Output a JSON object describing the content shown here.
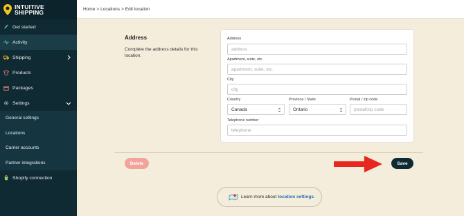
{
  "brand": {
    "line1": "INTUITIVE",
    "line2": "SHIPPING",
    "accent": "#f5c518"
  },
  "sidebar": {
    "items": [
      {
        "label": "Get started",
        "icon": "rocket-icon"
      },
      {
        "label": "Activity",
        "icon": "activity-icon",
        "active": true
      },
      {
        "label": "Shipping",
        "icon": "truck-icon",
        "chevron": "right"
      },
      {
        "label": "Products",
        "icon": "shirt-icon"
      },
      {
        "label": "Packages",
        "icon": "package-icon"
      },
      {
        "label": "Settings",
        "icon": "gear-icon",
        "chevron": "down"
      }
    ],
    "sub_items": [
      "General settings",
      "Locations",
      "Carrier accounts",
      "Partner integrations"
    ],
    "shopify": {
      "label": "Shopify connection",
      "icon": "shopify-icon"
    }
  },
  "breadcrumb": {
    "home": "Home",
    "sep": ">",
    "locations": "Locations",
    "current": "Edit location"
  },
  "section": {
    "title": "Address",
    "description": "Complete the address details for this location."
  },
  "form": {
    "address": {
      "label": "Address",
      "placeholder": "address"
    },
    "apartment": {
      "label": "Apartment, suite, etc.",
      "placeholder": "apartment, suite, etc."
    },
    "city": {
      "label": "City",
      "placeholder": "city"
    },
    "country": {
      "label": "Country",
      "value": "Canada"
    },
    "province": {
      "label": "Province / State",
      "value": "Ontario"
    },
    "postal": {
      "label": "Postal / zip code",
      "placeholder": "postal/zip code"
    },
    "phone": {
      "label": "Telephone number",
      "placeholder": "telephone"
    }
  },
  "actions": {
    "delete": "Delete",
    "save": "Save"
  },
  "learn": {
    "prefix": "Learn more about",
    "link": "location settings",
    "suffix": "."
  },
  "colors": {
    "sidebar_bg": "#0f2a33",
    "content_bg": "#f5eddc",
    "delete_bg": "#f2a49c",
    "save_bg": "#0f2a33",
    "arrow": "#e8281e",
    "link": "#1f6fb2"
  }
}
